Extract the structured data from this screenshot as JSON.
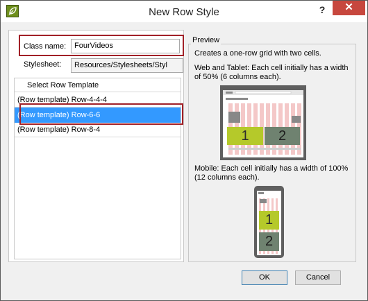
{
  "window": {
    "title": "New Row Style",
    "help_label": "?",
    "close_label": "✕",
    "app_icon": "app-leaf-icon"
  },
  "form": {
    "class_name_label": "Class name:",
    "class_name_value": "FourVideos",
    "stylesheet_label": "Stylesheet:",
    "stylesheet_value": "Resources/Stylesheets/Styl"
  },
  "templates": {
    "header": "Select Row Template",
    "items": [
      {
        "label": "(Row template) Row-4-4-4",
        "selected": false
      },
      {
        "label": "(Row template) Row-6-6",
        "selected": true
      },
      {
        "label": "(Row template) Row-8-4",
        "selected": false
      }
    ]
  },
  "preview": {
    "title": "Preview",
    "description": "Creates a one-row grid with two cells.",
    "web_text": "Web and Tablet: Each cell initially has a width of 50% (6 columns each).",
    "mobile_text": "Mobile: Each cell initially has a width of 100% (12 columns each).",
    "cell_1": "1",
    "cell_2": "2"
  },
  "buttons": {
    "ok": "OK",
    "cancel": "Cancel"
  },
  "colors": {
    "highlight_border": "#a12027",
    "selection": "#3399ff",
    "cell_1": "#b5c92a",
    "cell_2": "#6f8270",
    "grid_stripe": "#f4c8c8"
  }
}
